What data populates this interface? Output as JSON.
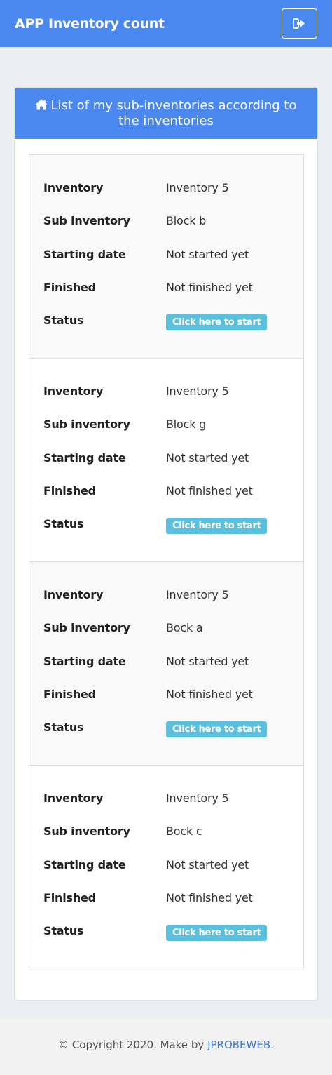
{
  "header": {
    "title": "APP Inventory count",
    "logout_icon": "sign-out-icon"
  },
  "card": {
    "title": "List of my sub-inventories according to the inventories",
    "title_icon": "home-icon"
  },
  "labels": {
    "inventory": "Inventory",
    "sub_inventory": "Sub inventory",
    "starting_date": "Starting date",
    "finished": "Finished",
    "status": "Status"
  },
  "entries": [
    {
      "inventory": "Inventory 5",
      "sub_inventory": "Block b",
      "starting_date": "Not started yet",
      "finished": "Not finished yet",
      "status_button": "Click here to start"
    },
    {
      "inventory": "Inventory 5",
      "sub_inventory": "Block g",
      "starting_date": "Not started yet",
      "finished": "Not finished yet",
      "status_button": "Click here to start"
    },
    {
      "inventory": "Inventory 5",
      "sub_inventory": "Bock a",
      "starting_date": "Not started yet",
      "finished": "Not finished yet",
      "status_button": "Click here to start"
    },
    {
      "inventory": "Inventory 5",
      "sub_inventory": "Bock c",
      "starting_date": "Not started yet",
      "finished": "Not finished yet",
      "status_button": "Click here to start"
    }
  ],
  "footer": {
    "prefix": "© Copyright 2020. Make by ",
    "link": "JPROBEWEB",
    "suffix": "."
  },
  "colors": {
    "primary": "#4a87ee",
    "info_button": "#5bc0de",
    "background": "#ebeff4"
  }
}
